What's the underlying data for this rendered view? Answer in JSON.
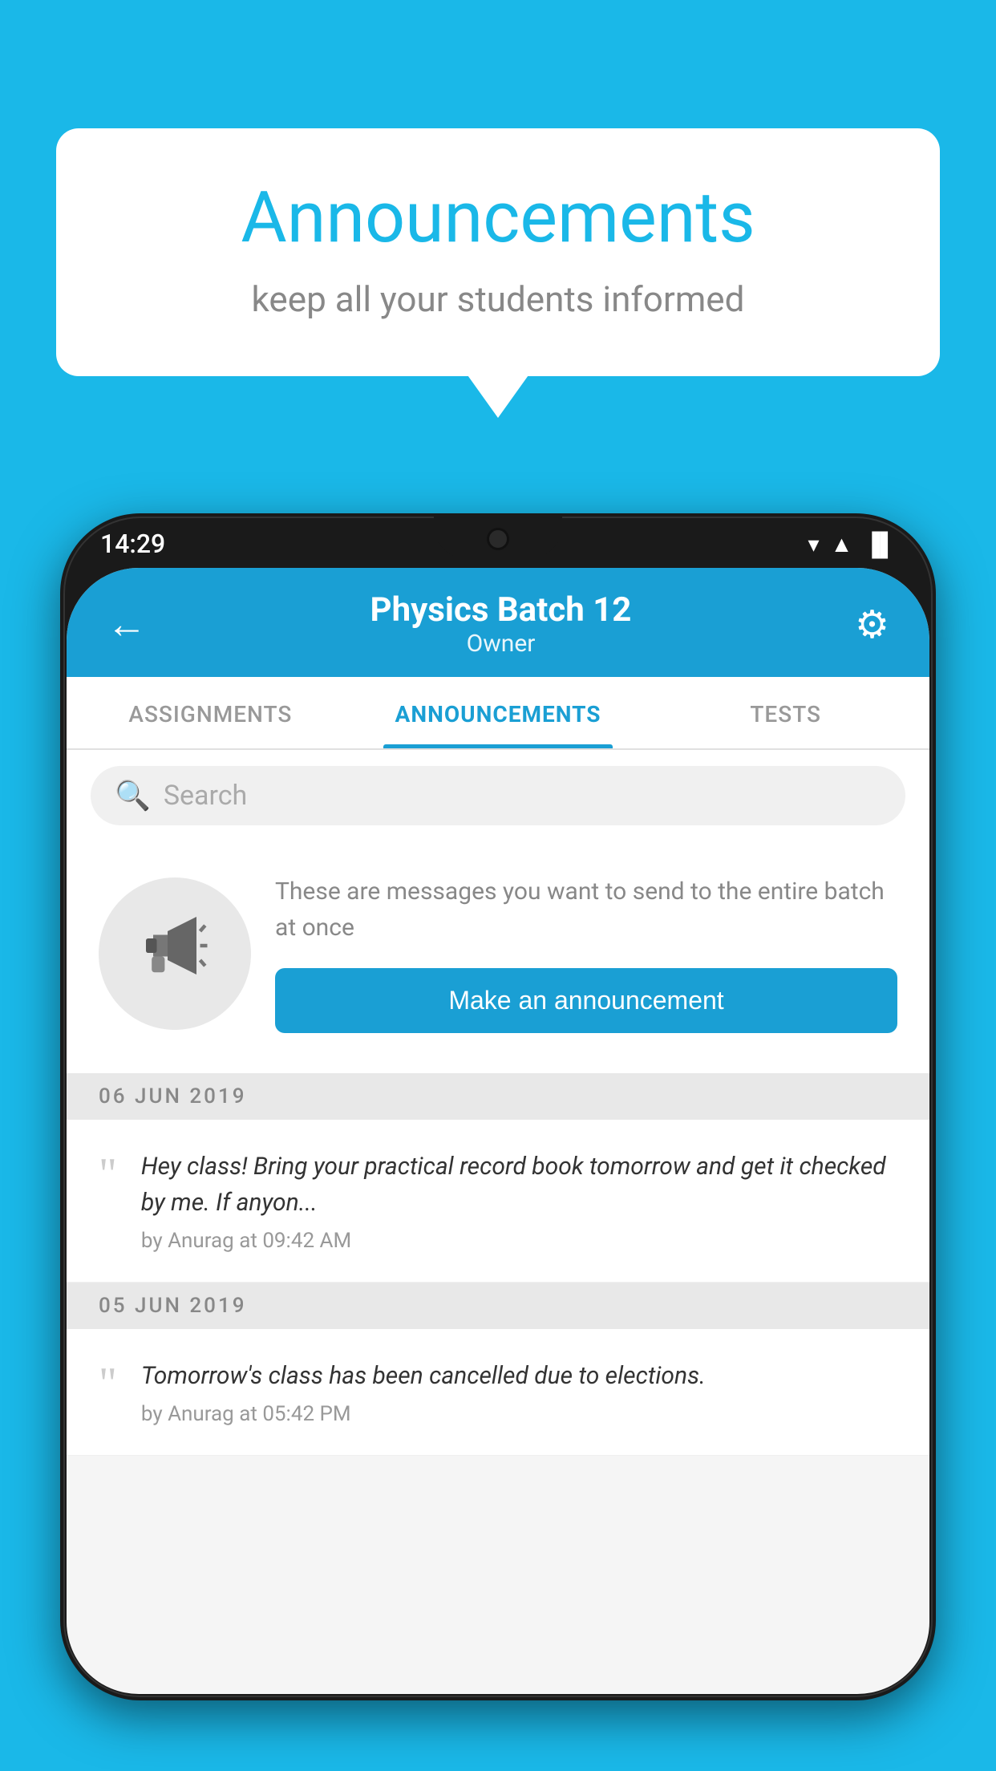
{
  "speech_bubble": {
    "title": "Announcements",
    "subtitle": "keep all your students informed"
  },
  "status_bar": {
    "time": "14:29",
    "signal_icon": "▼",
    "network_icon": "◂▸",
    "battery_icon": "▐"
  },
  "app_header": {
    "back_icon": "←",
    "title": "Physics Batch 12",
    "subtitle": "Owner",
    "settings_icon": "⚙"
  },
  "tabs": [
    {
      "label": "ASSIGNMENTS",
      "active": false
    },
    {
      "label": "ANNOUNCEMENTS",
      "active": true
    },
    {
      "label": "TESTS",
      "active": false
    }
  ],
  "search": {
    "placeholder": "Search"
  },
  "promo": {
    "description": "These are messages you want to send to the entire batch at once",
    "button_label": "Make an announcement"
  },
  "announcements": [
    {
      "date": "06  JUN  2019",
      "text": "Hey class! Bring your practical record book tomorrow and get it checked by me. If anyon...",
      "author": "by Anurag at 09:42 AM"
    },
    {
      "date": "05  JUN  2019",
      "text": "Tomorrow's class has been cancelled due to elections.",
      "author": "by Anurag at 05:42 PM"
    }
  ]
}
